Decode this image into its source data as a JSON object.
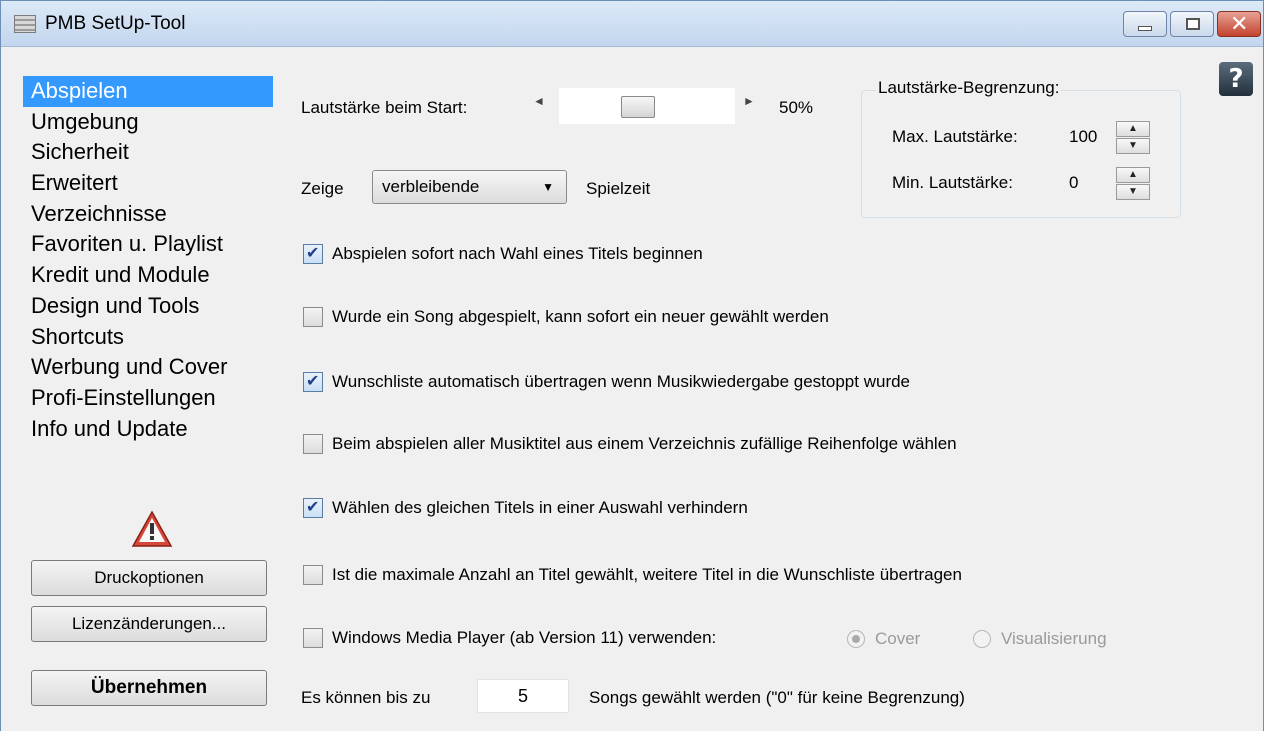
{
  "window": {
    "title": "PMB SetUp-Tool",
    "close_glyph": "✕"
  },
  "help": {
    "label": "?"
  },
  "sidebar": {
    "items": [
      {
        "label": "Abspielen",
        "active": true
      },
      {
        "label": "Umgebung"
      },
      {
        "label": "Sicherheit"
      },
      {
        "label": "Erweitert"
      },
      {
        "label": "Verzeichnisse"
      },
      {
        "label": "Favoriten u. Playlist"
      },
      {
        "label": "Kredit und Module"
      },
      {
        "label": "Design und Tools"
      },
      {
        "label": "Shortcuts"
      },
      {
        "label": "Werbung und Cover"
      },
      {
        "label": "Profi-Einstellungen"
      },
      {
        "label": "Info und Update"
      }
    ],
    "warning_icon": "warning-triangle-icon",
    "buttons": {
      "print": "Druckoptionen",
      "license": "Lizenzänderungen...",
      "apply": "Übernehmen"
    }
  },
  "volume": {
    "label": "Lautstärke beim Start:",
    "value_text": "50%",
    "level": 0.5,
    "left_arrow": "◄",
    "right_arrow": "►"
  },
  "show": {
    "prefix": "Zeige",
    "selected": "verbleibende",
    "suffix": "Spielzeit",
    "caret": "▼"
  },
  "limit_group": {
    "title": "Lautstärke-Begrenzung:",
    "max_label": "Max. Lautstärke:",
    "max_value": "100",
    "min_label": "Min. Lautstärke:",
    "min_value": "0",
    "spin_up": "▲",
    "spin_down": "▼"
  },
  "options": [
    {
      "label": "Abspielen sofort nach Wahl eines Titels beginnen",
      "checked": true
    },
    {
      "label": "Wurde ein Song abgespielt, kann sofort ein neuer gewählt werden",
      "checked": false
    },
    {
      "label": "Wunschliste automatisch übertragen wenn Musikwiedergabe gestoppt wurde",
      "checked": true
    },
    {
      "label": "Beim abspielen aller Musiktitel aus einem Verzeichnis zufällige Reihenfolge wählen",
      "checked": false
    },
    {
      "label": "Wählen des gleichen Titels in einer Auswahl verhindern",
      "checked": true
    },
    {
      "label": "Ist die maximale Anzahl an Titel gewählt, weitere Titel in die Wunschliste übertragen",
      "checked": false
    },
    {
      "label": "Windows Media Player (ab Version 11) verwenden:",
      "checked": false
    }
  ],
  "wmp": {
    "cover_label": "Cover",
    "cover_selected": true,
    "vis_label": "Visualisierung",
    "vis_selected": false
  },
  "songs": {
    "prefix": "Es können bis zu",
    "value": "5",
    "suffix": "Songs gewählt werden (\"0\" für keine Begrenzung)"
  }
}
